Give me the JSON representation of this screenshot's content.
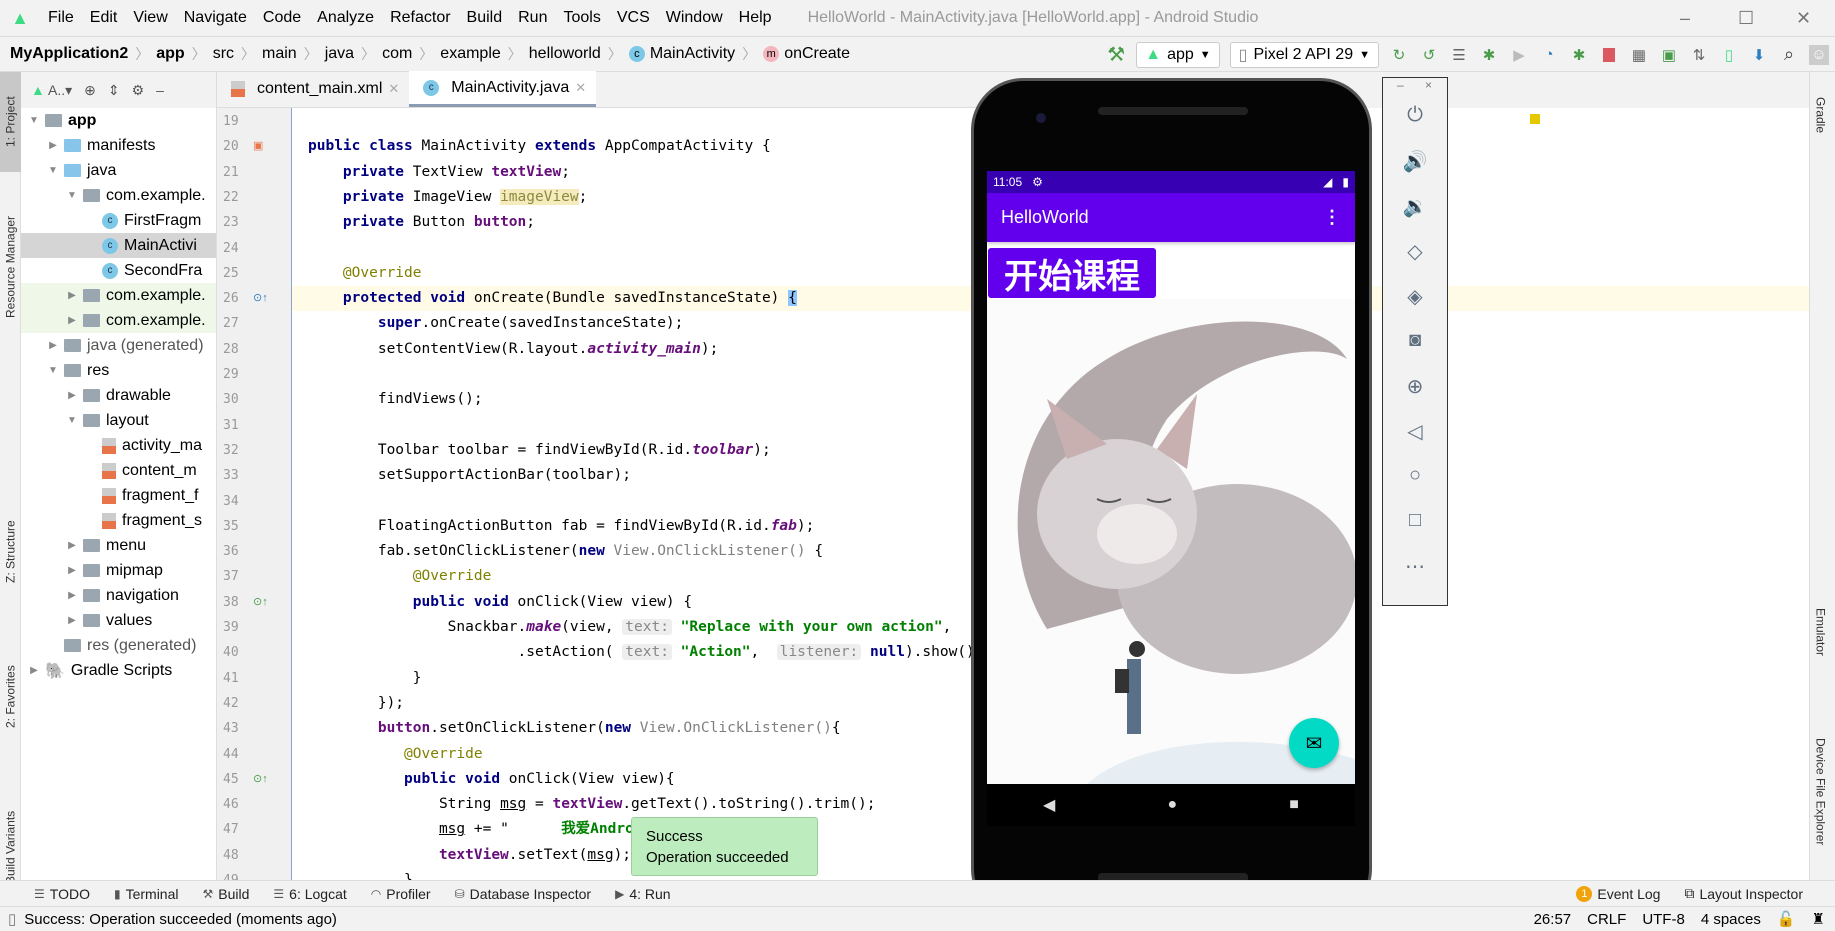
{
  "window": {
    "title": "HelloWorld - MainActivity.java [HelloWorld.app] - Android Studio",
    "minimize": "–",
    "maximize": "☐",
    "close": "✕"
  },
  "menu": [
    "File",
    "Edit",
    "View",
    "Navigate",
    "Code",
    "Analyze",
    "Refactor",
    "Build",
    "Run",
    "Tools",
    "VCS",
    "Window",
    "Help"
  ],
  "breadcrumb": [
    "MyApplication2",
    "app",
    "src",
    "main",
    "java",
    "com",
    "example",
    "helloworld",
    "MainActivity",
    "onCreate"
  ],
  "toolbar": {
    "module": "app",
    "device": "Pixel 2 API 29"
  },
  "side_tabs": {
    "project": "1: Project",
    "resource_manager": "Resource Manager",
    "structure": "Z: Structure",
    "favorites": "2: Favorites",
    "build_variants": "Build Variants",
    "gradle": "Gradle",
    "emulator": "Emulator",
    "device_file_explorer": "Device File Explorer"
  },
  "project_toolbar": {
    "view": "A..▾"
  },
  "tree": [
    {
      "label": "app",
      "depth": 0,
      "arrow": "▼",
      "icon": "module"
    },
    {
      "label": "manifests",
      "depth": 1,
      "arrow": "▶",
      "icon": "folder-blue"
    },
    {
      "label": "java",
      "depth": 1,
      "arrow": "▼",
      "icon": "folder-blue"
    },
    {
      "label": "com.example.",
      "depth": 2,
      "arrow": "▼",
      "icon": "package"
    },
    {
      "label": "FirstFragm",
      "depth": 3,
      "arrow": "",
      "icon": "class"
    },
    {
      "label": "MainActivi",
      "depth": 3,
      "arrow": "",
      "icon": "class",
      "selected": true
    },
    {
      "label": "SecondFra",
      "depth": 3,
      "arrow": "",
      "icon": "class"
    },
    {
      "label": "com.example.",
      "depth": 2,
      "arrow": "▶",
      "icon": "package",
      "test": true
    },
    {
      "label": "com.example.",
      "depth": 2,
      "arrow": "▶",
      "icon": "package",
      "test": true
    },
    {
      "label": "java (generated)",
      "depth": 1,
      "arrow": "▶",
      "icon": "folder-gen"
    },
    {
      "label": "res",
      "depth": 1,
      "arrow": "▼",
      "icon": "res"
    },
    {
      "label": "drawable",
      "depth": 2,
      "arrow": "▶",
      "icon": "package"
    },
    {
      "label": "layout",
      "depth": 2,
      "arrow": "▼",
      "icon": "package"
    },
    {
      "label": "activity_ma",
      "depth": 3,
      "arrow": "",
      "icon": "xml"
    },
    {
      "label": "content_m",
      "depth": 3,
      "arrow": "",
      "icon": "xml"
    },
    {
      "label": "fragment_f",
      "depth": 3,
      "arrow": "",
      "icon": "xml"
    },
    {
      "label": "fragment_s",
      "depth": 3,
      "arrow": "",
      "icon": "xml"
    },
    {
      "label": "menu",
      "depth": 2,
      "arrow": "▶",
      "icon": "package"
    },
    {
      "label": "mipmap",
      "depth": 2,
      "arrow": "▶",
      "icon": "package"
    },
    {
      "label": "navigation",
      "depth": 2,
      "arrow": "▶",
      "icon": "package"
    },
    {
      "label": "values",
      "depth": 2,
      "arrow": "▶",
      "icon": "package"
    },
    {
      "label": "res (generated)",
      "depth": 1,
      "arrow": "",
      "icon": "res"
    },
    {
      "label": "Gradle Scripts",
      "depth": 0,
      "arrow": "▶",
      "icon": "gradle"
    }
  ],
  "tabs": [
    {
      "label": "content_main.xml",
      "icon": "xml"
    },
    {
      "label": "MainActivity.java",
      "icon": "class",
      "active": true
    }
  ],
  "code": [
    {
      "n": 19,
      "s": []
    },
    {
      "n": 20,
      "s": [
        [
          "kw",
          "public class "
        ],
        [
          "",
          "MainActivity "
        ],
        [
          "kw",
          "extends "
        ],
        [
          "",
          "AppCompatActivity {"
        ]
      ]
    },
    {
      "n": 21,
      "s": [
        [
          "",
          "    "
        ],
        [
          "kw",
          "private "
        ],
        [
          "",
          "TextView "
        ],
        [
          "fld",
          "textView"
        ],
        [
          "",
          ";"
        ]
      ]
    },
    {
      "n": 22,
      "s": [
        [
          "",
          "    "
        ],
        [
          "kw",
          "private "
        ],
        [
          "",
          "ImageView "
        ],
        [
          "warn",
          "imageView"
        ],
        [
          "",
          ";"
        ]
      ]
    },
    {
      "n": 23,
      "s": [
        [
          "",
          "    "
        ],
        [
          "kw",
          "private "
        ],
        [
          "",
          "Button "
        ],
        [
          "fld",
          "button"
        ],
        [
          "",
          ";"
        ]
      ]
    },
    {
      "n": 24,
      "s": []
    },
    {
      "n": 25,
      "s": [
        [
          "",
          "    "
        ],
        [
          "ann",
          "@Override"
        ]
      ]
    },
    {
      "n": 26,
      "s": [
        [
          "",
          "    "
        ],
        [
          "kw",
          "protected void "
        ],
        [
          "",
          "onCreate(Bundle savedInstanceState) "
        ],
        [
          "cursor",
          "{"
        ]
      ]
    },
    {
      "n": 27,
      "s": [
        [
          "",
          "        "
        ],
        [
          "kw",
          "super"
        ],
        [
          "",
          ".onCreate(savedInstanceState);"
        ]
      ]
    },
    {
      "n": 28,
      "s": [
        [
          "",
          "        setContentView(R.layout."
        ],
        [
          "ital",
          "activity_main"
        ],
        [
          "",
          ");"
        ]
      ]
    },
    {
      "n": 29,
      "s": []
    },
    {
      "n": 30,
      "s": [
        [
          "",
          "        findViews();"
        ]
      ]
    },
    {
      "n": 31,
      "s": []
    },
    {
      "n": 32,
      "s": [
        [
          "",
          "        Toolbar toolbar = findViewById(R.id."
        ],
        [
          "ital",
          "toolbar"
        ],
        [
          "",
          ");"
        ]
      ]
    },
    {
      "n": 33,
      "s": [
        [
          "",
          "        setSupportActionBar(toolbar);"
        ]
      ]
    },
    {
      "n": 34,
      "s": []
    },
    {
      "n": 35,
      "s": [
        [
          "",
          "        FloatingActionButton fab = findViewById(R.id."
        ],
        [
          "ital",
          "fab"
        ],
        [
          "",
          ");"
        ]
      ]
    },
    {
      "n": 36,
      "s": [
        [
          "",
          "        fab.setOnClickListener("
        ],
        [
          "kw",
          "new "
        ],
        [
          "gray",
          "View.OnClickListener() "
        ],
        [
          "",
          "{"
        ]
      ]
    },
    {
      "n": 37,
      "s": [
        [
          "",
          "            "
        ],
        [
          "ann",
          "@Override"
        ]
      ]
    },
    {
      "n": 38,
      "s": [
        [
          "",
          "            "
        ],
        [
          "kw",
          "public void "
        ],
        [
          "",
          "onClick(View view) {"
        ]
      ]
    },
    {
      "n": 39,
      "s": [
        [
          "",
          "                Snackbar."
        ],
        [
          "ital",
          "make"
        ],
        [
          "",
          "(view, "
        ],
        [
          "hint",
          "text:"
        ],
        [
          "",
          " "
        ],
        [
          "str",
          "\"Replace with your own action\""
        ],
        [
          "",
          ","
        ]
      ]
    },
    {
      "n": 40,
      "s": [
        [
          "",
          "                        .setAction( "
        ],
        [
          "hint",
          "text:"
        ],
        [
          "",
          " "
        ],
        [
          "str",
          "\"Action\""
        ],
        [
          "",
          ",  "
        ],
        [
          "hint",
          "listener:"
        ],
        [
          "",
          " "
        ],
        [
          "kw",
          "null"
        ],
        [
          "",
          ").show();"
        ]
      ]
    },
    {
      "n": 41,
      "s": [
        [
          "",
          "            }"
        ]
      ]
    },
    {
      "n": 42,
      "s": [
        [
          "",
          "        });"
        ]
      ]
    },
    {
      "n": 43,
      "s": [
        [
          "",
          "        "
        ],
        [
          "fld",
          "button"
        ],
        [
          "",
          ".setOnClickListener("
        ],
        [
          "kw",
          "new "
        ],
        [
          "gray",
          "View.OnClickListener()"
        ],
        [
          "",
          "{"
        ]
      ]
    },
    {
      "n": 44,
      "s": [
        [
          "",
          "           "
        ],
        [
          "ann",
          "@Override"
        ]
      ]
    },
    {
      "n": 45,
      "s": [
        [
          "",
          "           "
        ],
        [
          "kw",
          "public void "
        ],
        [
          "",
          "onClick(View view){"
        ]
      ]
    },
    {
      "n": 46,
      "s": [
        [
          "",
          "               String "
        ],
        [
          "und",
          "msg"
        ],
        [
          "",
          " = "
        ],
        [
          "fld",
          "textView"
        ],
        [
          "",
          ".getText().toString().trim();"
        ]
      ]
    },
    {
      "n": 47,
      "s": [
        [
          "",
          "               "
        ],
        [
          "und",
          "msg"
        ],
        [
          "",
          " += \"      "
        ],
        [
          "str",
          "我爱Android编程!"
        ],
        [
          "",
          "\";"
        ]
      ]
    },
    {
      "n": 48,
      "s": [
        [
          "",
          "               "
        ],
        [
          "fld",
          "textView"
        ],
        [
          "",
          ".setText("
        ],
        [
          "und",
          "msg"
        ],
        [
          "",
          ");"
        ]
      ]
    },
    {
      "n": 49,
      "s": [
        [
          "",
          "           }"
        ]
      ]
    }
  ],
  "toast": {
    "title": "Success",
    "message": "Operation succeeded"
  },
  "bottom_tabs": [
    "TODO",
    "Terminal",
    "Build",
    "6: Logcat",
    "Profiler",
    "Database Inspector",
    "4: Run"
  ],
  "bottom_right": {
    "event_log": "Event Log",
    "event_count": "1",
    "layout_inspector": "Layout Inspector"
  },
  "status": {
    "message": "Success: Operation succeeded (moments ago)",
    "position": "26:57",
    "line_sep": "CRLF",
    "encoding": "UTF-8",
    "indent": "4 spaces"
  },
  "phone": {
    "time": "11:05",
    "app_title": "HelloWorld",
    "button_label": "开始课程",
    "colors": {
      "primary": "#6200ee",
      "primary_dark": "#3700b3",
      "fab": "#03dac5"
    }
  },
  "emulator_controls": [
    "power",
    "volume-up",
    "volume-down",
    "rotate-left",
    "rotate-right",
    "screenshot",
    "zoom",
    "back",
    "home",
    "overview",
    "more"
  ]
}
